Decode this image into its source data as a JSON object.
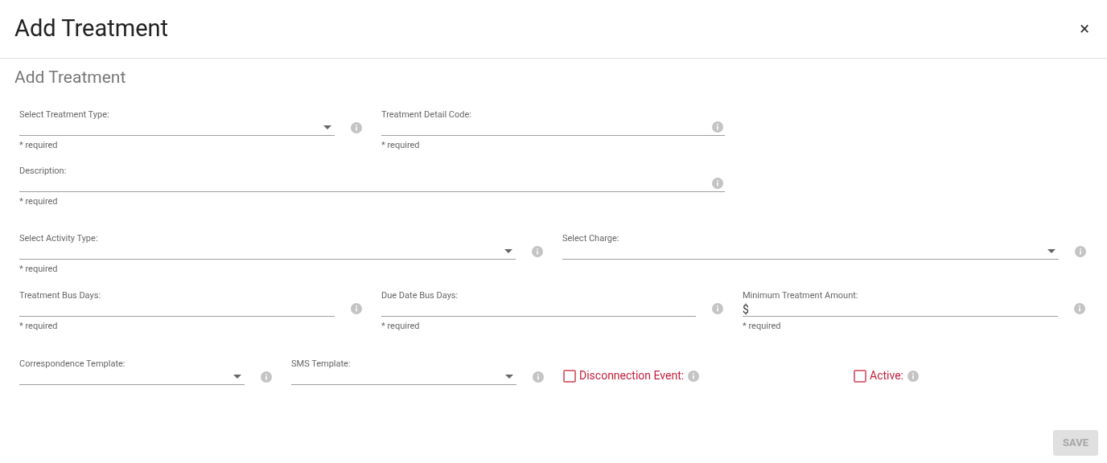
{
  "dialog": {
    "title": "Add Treatment",
    "close": "×"
  },
  "form": {
    "heading": "Add Treatment",
    "rows": [
      [
        {
          "kind": "select",
          "label": "Select Treatment Type:",
          "hint": "* required"
        },
        {
          "kind": "text",
          "label": "Treatment Detail Code:",
          "hint": "* required"
        }
      ],
      [
        {
          "kind": "text",
          "label": "Description:",
          "hint": "* required"
        }
      ],
      [
        {
          "kind": "select",
          "label": "Select Activity Type:",
          "hint": "* required"
        },
        {
          "kind": "select",
          "label": "Select Charge:"
        }
      ],
      [
        {
          "kind": "text",
          "label": "Treatment Bus Days:",
          "hint": "* required"
        },
        {
          "kind": "text",
          "label": "Due Date Bus Days:",
          "hint": "* required"
        },
        {
          "kind": "text",
          "label": "Minimum Treatment Amount:",
          "prefix": "$",
          "hint": "* required"
        }
      ],
      [
        {
          "kind": "select",
          "label": "Correspondence Template:"
        },
        {
          "kind": "select",
          "label": "SMS Template:"
        },
        {
          "kind": "checkbox",
          "label": "Disconnection Event:",
          "checked": false
        },
        {
          "kind": "checkbox",
          "label": "Active:",
          "checked": false
        }
      ]
    ]
  },
  "save_button": {
    "label": "SAVE",
    "disabled": true
  }
}
